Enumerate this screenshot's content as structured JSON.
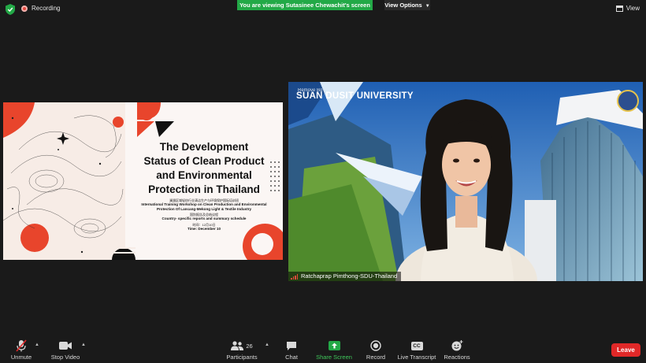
{
  "topbar": {
    "recording_label": "Recording",
    "banner_text": "You are viewing Sutasinee Chewachit's screen",
    "view_options_label": "View Options",
    "view_label": "View"
  },
  "slide": {
    "title_line1": "The Development",
    "title_line2": "Status of Clean Product",
    "title_line3": "and Environmental",
    "title_line4": "Protection in Thailand",
    "cn_line": "澜湄区域轻纺行业清洁生产与环境保护国际培训班",
    "en_line1": "International Training Workshop on Clean Production and Environmental",
    "en_line2": "Protection Of Lancang-Mekong Light & Textile Industry",
    "cn_line2": "国别报告及总结议程",
    "country_line": "Country- specific reports and summary schedule",
    "cn_time": "时间：12月10日",
    "time_line": "Time: December 10"
  },
  "video": {
    "university": "SUAN DUSIT UNIVERSITY",
    "remove_bg": "Remove Bg",
    "participant_name": "Ratchaprap Pimthong-SDU-Thailand"
  },
  "toolbar": {
    "unmute": "Unmute",
    "stop_video": "Stop Video",
    "participants": "Participants",
    "participants_count": "26",
    "chat": "Chat",
    "share_screen": "Share Screen",
    "record": "Record",
    "live_transcript": "Live Transcript",
    "reactions": "Reactions",
    "leave": "Leave",
    "cc_icon_text": "CC"
  },
  "colors": {
    "banner_green": "#23a947",
    "leave_red": "#e02828",
    "share_green": "#23a947",
    "slide_accent": "#e8452c"
  }
}
